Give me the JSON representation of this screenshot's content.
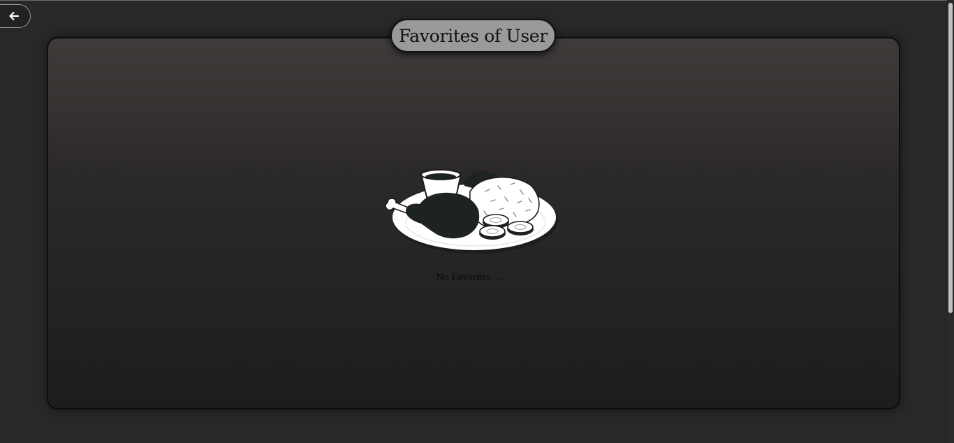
{
  "page": {
    "title": "Favorites of User",
    "empty_message": "No Favorites...."
  },
  "nav": {
    "back_icon": "arrow-left-icon"
  },
  "illustration": {
    "icon": "food-plate-icon"
  },
  "colors": {
    "background": "#282828",
    "panel_top": "#3f3b3a",
    "panel_bottom": "#1d1d1d",
    "title_pill": "#9a9a9a",
    "text_dark": "#111111"
  }
}
